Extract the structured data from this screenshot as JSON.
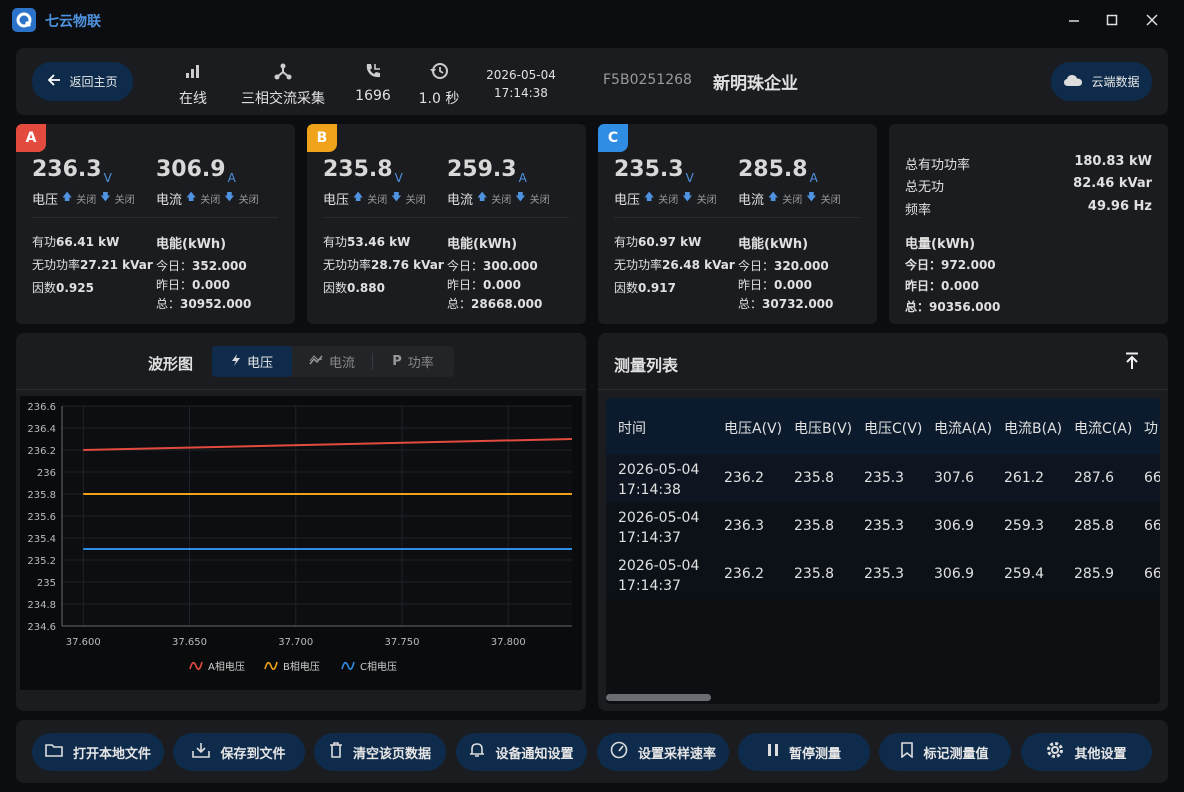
{
  "app": {
    "title": "七云物联"
  },
  "header": {
    "back_label": "返回主页",
    "status_label": "在线",
    "mode_label": "三相交流采集",
    "count_label": "1696",
    "interval_label": "1.0 秒",
    "date": "2026-05-04",
    "time": "17:14:38",
    "device_id": "F5B0251268",
    "company": "新明珠企业",
    "cloud_label": "云端数据"
  },
  "phases": [
    {
      "tag": "A",
      "color": "#e34b3f",
      "voltage": "236.3",
      "current": "306.9",
      "active": "66.41 kW",
      "reactive": "27.21 kVar",
      "pf": "0.925",
      "today": "352.000",
      "yesterday": "0.000",
      "total": "30952.000"
    },
    {
      "tag": "B",
      "color": "#f0a21a",
      "voltage": "235.8",
      "current": "259.3",
      "active": "53.46 kW",
      "reactive": "28.76 kVar",
      "pf": "0.880",
      "today": "300.000",
      "yesterday": "0.000",
      "total": "28668.000"
    },
    {
      "tag": "C",
      "color": "#2f8de4",
      "voltage": "235.3",
      "current": "285.8",
      "active": "60.97 kW",
      "reactive": "26.48 kVar",
      "pf": "0.917",
      "today": "320.000",
      "yesterday": "0.000",
      "total": "30732.000"
    }
  ],
  "phase_labels": {
    "v_unit": "V",
    "a_unit": "A",
    "voltage": "电压",
    "current": "电流",
    "up_off": "关闭",
    "down_off": "关闭",
    "active_prefix": "有功",
    "reactive_prefix": "无功功率",
    "pf_prefix": "因数",
    "energy_head": "电能(kWh)",
    "today_prefix": "今日：",
    "yesterday_prefix": "昨日：",
    "total_prefix": "总："
  },
  "totals": {
    "active_label": "总有功功率",
    "active_value": "180.83 kW",
    "reactive_label": "总无功",
    "reactive_value": "82.46 kVar",
    "freq_label": "频率",
    "freq_value": "49.96 Hz",
    "energy_head": "电量(kWh)",
    "today": "今日：972.000",
    "yesterday": "昨日：0.000",
    "total": "总：90356.000"
  },
  "wave": {
    "title": "波形图",
    "tabs": [
      {
        "label": "电压",
        "active": true
      },
      {
        "label": "电流",
        "active": false
      },
      {
        "label": "功率",
        "active": false
      }
    ]
  },
  "chart_data": {
    "type": "line",
    "x": [
      37.6,
      37.83
    ],
    "xticks": [
      "37.600",
      "37.650",
      "37.700",
      "37.750",
      "37.800"
    ],
    "yticks": [
      "236.6",
      "236.4",
      "236.2",
      "236",
      "235.8",
      "235.6",
      "235.4",
      "235.2",
      "235",
      "234.8",
      "234.6"
    ],
    "ylim": [
      234.6,
      236.6
    ],
    "xlim": [
      37.59,
      37.83
    ],
    "series": [
      {
        "name": "A相电压",
        "color": "#e34b3f",
        "values": [
          236.2,
          236.3
        ]
      },
      {
        "name": "B相电压",
        "color": "#f0a21a",
        "values": [
          235.8,
          235.8
        ]
      },
      {
        "name": "C相电压",
        "color": "#2f8de4",
        "values": [
          235.3,
          235.3
        ]
      }
    ],
    "legend": "bottom",
    "grid": true
  },
  "table": {
    "title": "测量列表",
    "columns": [
      "时间",
      "电压A(V)",
      "电压B(V)",
      "电压C(V)",
      "电流A(A)",
      "电流B(A)",
      "电流C(A)",
      "功"
    ],
    "rows": [
      {
        "date": "2026-05-04",
        "time": "17:14:38",
        "cells": [
          "236.2",
          "235.8",
          "235.3",
          "307.6",
          "261.2",
          "287.6",
          "66"
        ]
      },
      {
        "date": "2026-05-04",
        "time": "17:14:37",
        "cells": [
          "236.3",
          "235.8",
          "235.3",
          "306.9",
          "259.3",
          "285.8",
          "66"
        ]
      },
      {
        "date": "2026-05-04",
        "time": "17:14:37",
        "cells": [
          "236.2",
          "235.8",
          "235.3",
          "306.9",
          "259.4",
          "285.9",
          "66"
        ]
      }
    ]
  },
  "toolbar": {
    "open_file": "打开本地文件",
    "save_file": "保存到文件",
    "clear": "清空该页数据",
    "notify": "设备通知设置",
    "rate": "设置采样速率",
    "pause": "暂停测量",
    "mark": "标记测量值",
    "other": "其他设置"
  }
}
